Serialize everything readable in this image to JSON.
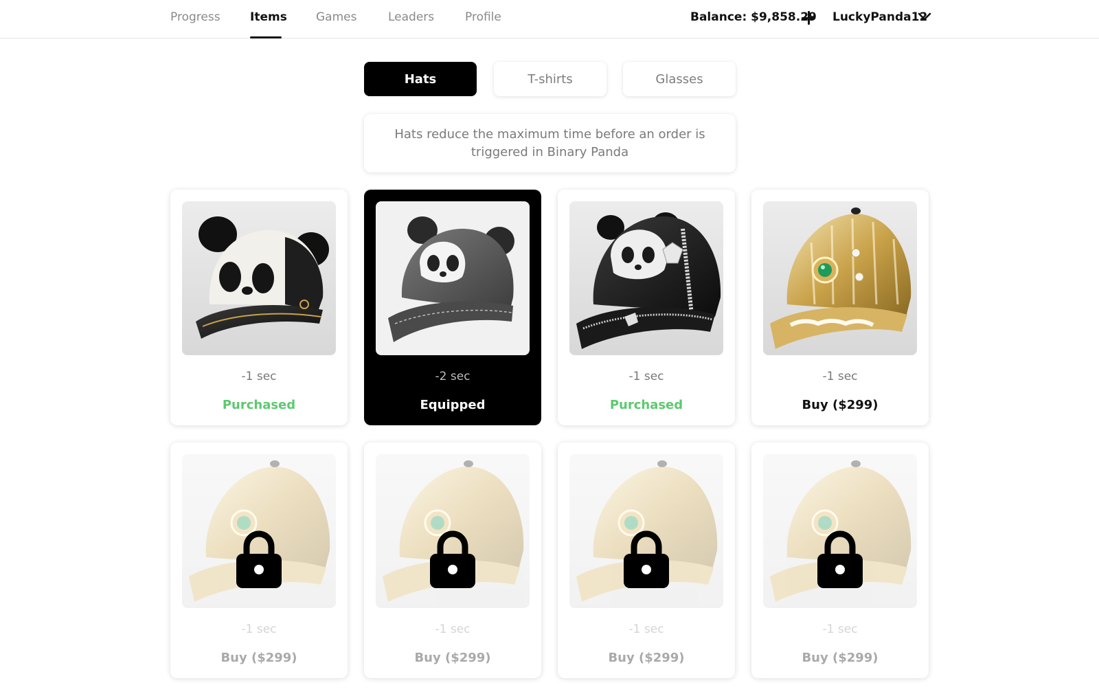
{
  "nav": {
    "items": [
      {
        "label": "Progress",
        "active": false
      },
      {
        "label": "Items",
        "active": true
      },
      {
        "label": "Games",
        "active": false
      },
      {
        "label": "Leaders",
        "active": false
      },
      {
        "label": "Profile",
        "active": false
      }
    ]
  },
  "header": {
    "balance": "Balance: $9,858.29",
    "username": "LuckyPanda12",
    "add_icon": "plus-icon",
    "menu_icon": "chevron-down-icon"
  },
  "categories": [
    {
      "label": "Hats",
      "active": true
    },
    {
      "label": "T-shirts",
      "active": false
    },
    {
      "label": "Glasses",
      "active": false
    }
  ],
  "description": "Hats reduce the maximum time before an order is triggered in Binary Panda",
  "items": [
    {
      "time": "-1 sec",
      "status": "Purchased",
      "state": "purchased",
      "image": "panda-leather-cap"
    },
    {
      "time": "-2 sec",
      "status": "Equipped",
      "state": "equipped",
      "image": "gray-panda-cap"
    },
    {
      "time": "-1 sec",
      "status": "Purchased",
      "state": "purchased",
      "image": "jeweled-panda-cap"
    },
    {
      "time": "-1 sec",
      "status": "Buy ($299)",
      "state": "buy",
      "image": "gold-ornate-cap"
    },
    {
      "time": "-1 sec",
      "status": "Buy ($299)",
      "state": "locked",
      "image": "gold-ornate-cap"
    },
    {
      "time": "-1 sec",
      "status": "Buy ($299)",
      "state": "locked",
      "image": "gold-ornate-cap"
    },
    {
      "time": "-1 sec",
      "status": "Buy ($299)",
      "state": "locked",
      "image": "gold-ornate-cap"
    },
    {
      "time": "-1 sec",
      "status": "Buy ($299)",
      "state": "locked",
      "image": "gold-ornate-cap"
    }
  ],
  "colors": {
    "accent": "#000000",
    "purchased": "#5cc96f",
    "muted": "#8a8a8a"
  }
}
